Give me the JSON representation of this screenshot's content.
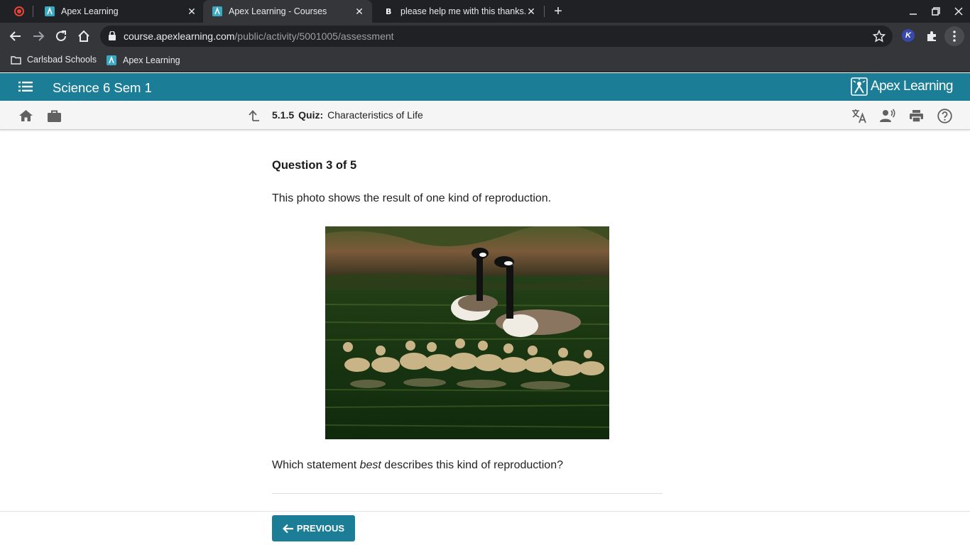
{
  "browser": {
    "tabs": [
      {
        "title": "Apex Learning",
        "active": false
      },
      {
        "title": "Apex Learning - Courses",
        "active": true
      },
      {
        "title": "please help me with this thanks.",
        "active": false
      }
    ],
    "url_host": "course.apexlearning.com",
    "url_path": "/public/activity/5001005/assessment",
    "bookmarks": [
      {
        "label": "Carlsbad Schools",
        "icon": "folder-icon"
      },
      {
        "label": "Apex Learning",
        "icon": "apex-favicon"
      }
    ],
    "extension_badge": "K"
  },
  "header": {
    "course_title": "Science 6 Sem 1",
    "logo_text": "Apex Learning",
    "brand_color": "#1b7e96"
  },
  "subnav": {
    "activity_number": "5.1.5",
    "activity_type": "Quiz:",
    "activity_title": "Characteristics of Life",
    "icons": [
      "home-icon",
      "briefcase-icon",
      "up-arrow-icon",
      "translate-icon",
      "read-aloud-icon",
      "print-icon",
      "help-icon"
    ]
  },
  "question": {
    "number_label": "Question 3 of 5",
    "prompt": "This photo shows the result of one kind of reproduction.",
    "stem_before": "Which statement ",
    "stem_emphasis": "best",
    "stem_after": " describes this kind of reproduction?"
  },
  "footer": {
    "previous_label": "PREVIOUS"
  }
}
